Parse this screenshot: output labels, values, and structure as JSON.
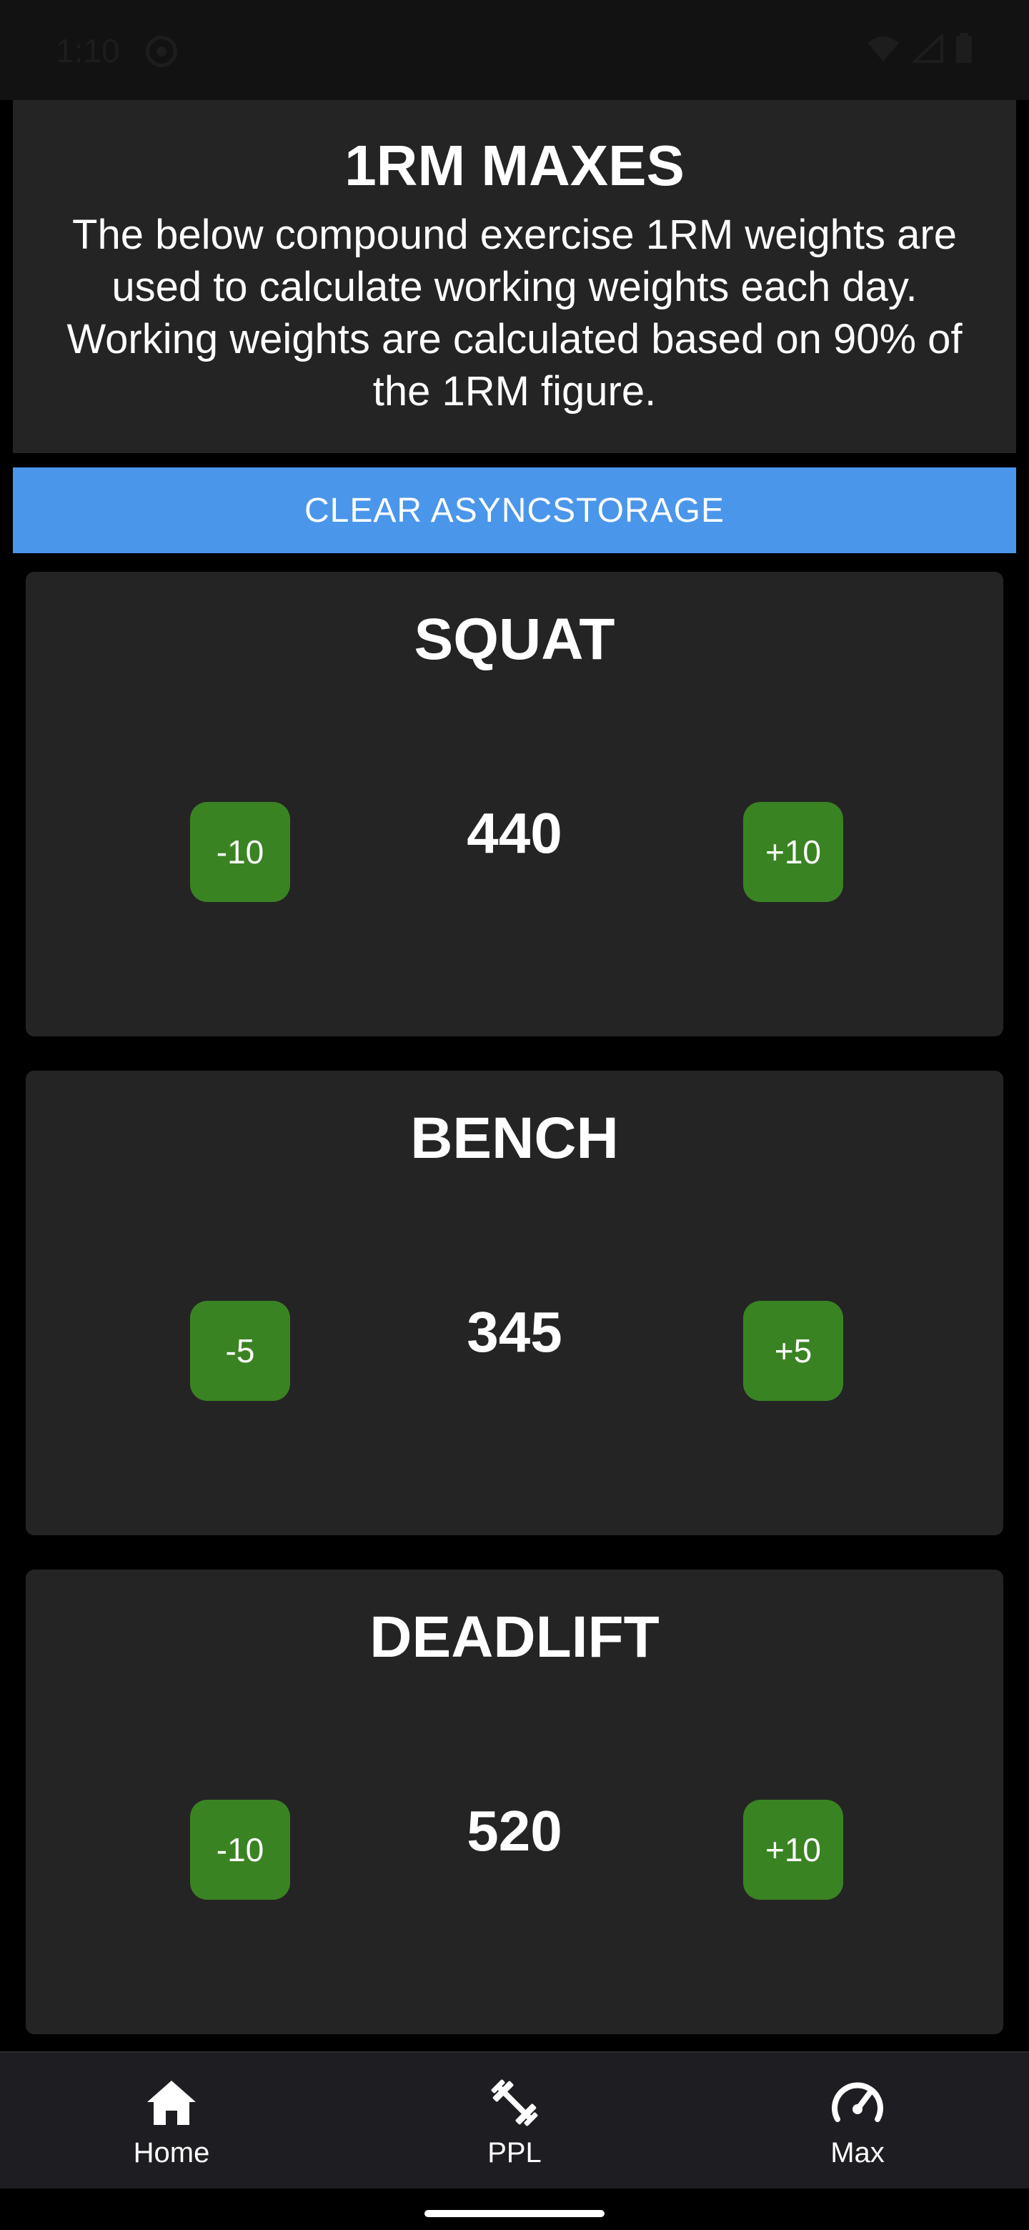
{
  "status_bar": {
    "time": "1:10"
  },
  "header": {
    "title": "1RM MAXES",
    "description": "The below compound exercise 1RM weights are used to calculate working weights each day. Working weights are calculated based on 90% of the 1RM figure."
  },
  "clear_button_label": "CLEAR ASYNCSTORAGE",
  "lifts": [
    {
      "name": "SQUAT",
      "value": "440",
      "minus_label": "-10",
      "plus_label": "+10"
    },
    {
      "name": "BENCH",
      "value": "345",
      "minus_label": "-5",
      "plus_label": "+5"
    },
    {
      "name": "DEADLIFT",
      "value": "520",
      "minus_label": "-10",
      "plus_label": "+10"
    }
  ],
  "tabs": [
    {
      "label": "Home",
      "icon": "home-icon"
    },
    {
      "label": "PPL",
      "icon": "dumbbell-icon"
    },
    {
      "label": "Max",
      "icon": "speedometer-icon"
    }
  ],
  "colors": {
    "accent_blue": "#4a96ea",
    "step_green": "#3a8323",
    "card_bg": "#242424",
    "tab_bar_bg": "#1e1d22"
  }
}
